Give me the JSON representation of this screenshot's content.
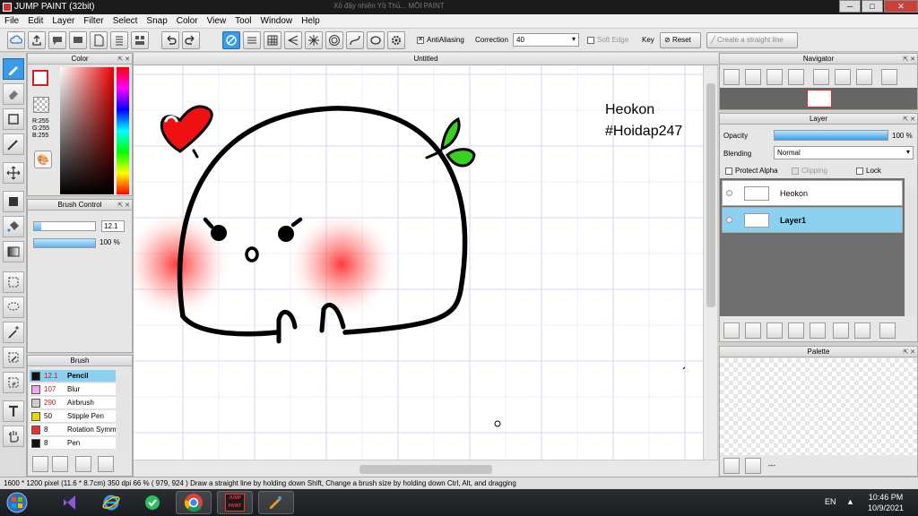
{
  "window": {
    "title": "JUMP PAINT (32bit)",
    "minimize": "─",
    "maximize": "□",
    "close": "✕",
    "ghost_tab": "Xỏ đậy nhiên Yồ Thủ... MỐI PAINT"
  },
  "menu": [
    "File",
    "Edit",
    "Layer",
    "Filter",
    "Select",
    "Snap",
    "Color",
    "View",
    "Tool",
    "Window",
    "Help"
  ],
  "toolbar": {
    "antialiasing_label": "AntiAliasing",
    "correction_label": "Correction",
    "correction_value": "40",
    "soft_edge_label": "Soft Edge",
    "key_label": "Key",
    "reset_label": "Reset",
    "straight_line_label": "Create a straight line"
  },
  "color_panel": {
    "title": "Color",
    "r": "R:255",
    "g": "G:255",
    "b": "B:255",
    "fg": "#ffffff"
  },
  "brush_control": {
    "title": "Brush Control",
    "size": "12.1",
    "opacity": "100 %",
    "size_fraction": 0.12,
    "opacity_fraction": 1.0
  },
  "brush_panel": {
    "title": "Brush",
    "items": [
      {
        "size": "12.1",
        "name": "Pencil",
        "color": "#111111",
        "selected": true
      },
      {
        "size": "107",
        "name": "Blur",
        "color": "#f6a6f0"
      },
      {
        "size": "290",
        "name": "Airbrush",
        "color": "#cccccc"
      },
      {
        "size": "50",
        "name": "Stipple Pen",
        "color": "#e8d400"
      },
      {
        "size": "8",
        "name": "Rotation Symmetry",
        "color": "#e83030"
      },
      {
        "size": "8",
        "name": "Pen",
        "color": "#111111"
      }
    ]
  },
  "document": {
    "title": "Untitled",
    "text_line1": "Heokon",
    "text_line2": "#Hoidap247"
  },
  "navigator": {
    "title": "Navigator"
  },
  "layer_panel": {
    "title": "Layer",
    "opacity_label": "Opacity",
    "opacity_value": "100 %",
    "opacity_fraction": 1.0,
    "blending_label": "Blending",
    "blending_value": "Normal",
    "protect_alpha": "Protect Alpha",
    "clipping": "Clipping",
    "lock": "Lock",
    "layers": [
      {
        "name": "Heokon",
        "selected": false
      },
      {
        "name": "Layer1",
        "selected": true
      }
    ]
  },
  "palette": {
    "title": "Palette",
    "footer": "---"
  },
  "status": {
    "size": "1600 * 1200 pixel",
    "cm": "(11.6 * 8.7cm)",
    "dpi": "350 dpi",
    "zoom": "66 %",
    "coords": "( 979, 924 )",
    "hint": "Draw a straight line by holding down Shift, Change a brush size by holding down Ctrl, Alt, and dragging"
  },
  "taskbar": {
    "lang": "EN",
    "time": "10:46 PM",
    "date": "10/9/2021",
    "jp_icon_text": "JUMP PAINT"
  }
}
